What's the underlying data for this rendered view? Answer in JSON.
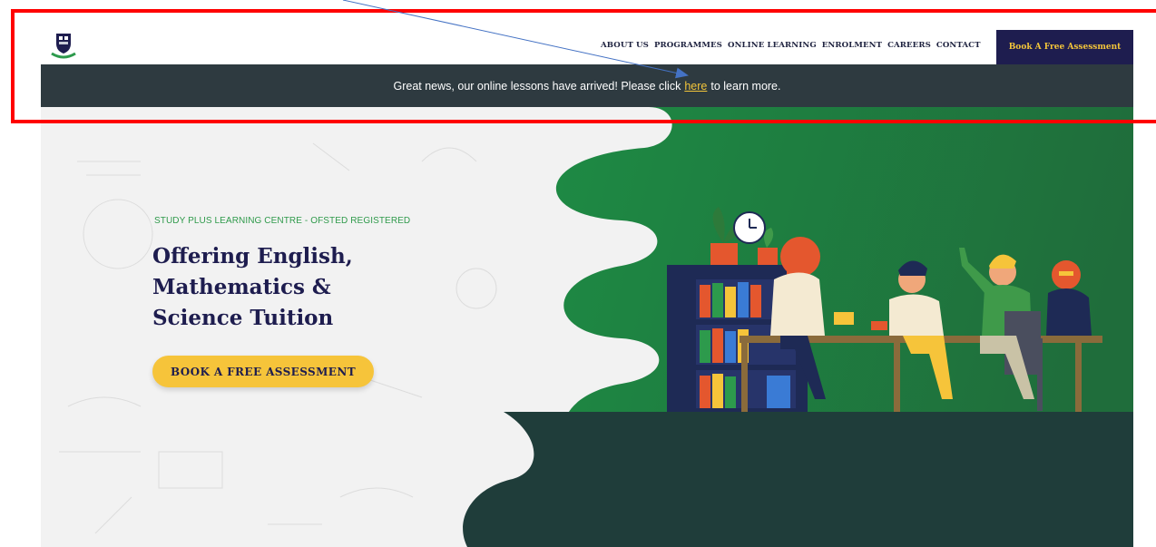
{
  "header": {
    "nav": [
      "ABOUT US",
      "PROGRAMMES",
      "ONLINE LEARNING",
      "ENROLMENT",
      "CAREERS",
      "CONTACT"
    ],
    "cta_label": "Book A Free Assessment",
    "logo_icon": "school-crest-icon"
  },
  "announcement": {
    "text_before": "Great news, our online lessons have arrived! Please click",
    "link_text": "here",
    "text_after": "to learn more."
  },
  "hero": {
    "kicker": "STUDY PLUS LEARNING CENTRE - OFSTED REGISTERED",
    "headline_lines": [
      "Offering English,",
      "Mathematics &",
      "Science Tuition"
    ],
    "cta_label": "BOOK A FREE ASSESSMENT",
    "illustration": "students-studying-at-table-illustration"
  },
  "colors": {
    "navy": "#1e1d4f",
    "yellow": "#f6c43a",
    "bar": "#2e3a40",
    "green": "#2d9a4c",
    "dark_green": "#1f3d3a",
    "annotation_red": "#ff0000"
  }
}
